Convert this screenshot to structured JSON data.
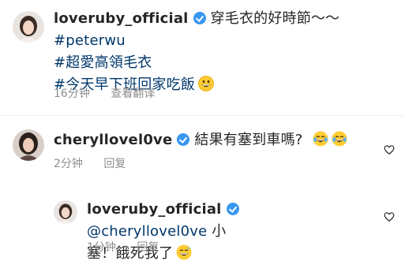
{
  "post": {
    "username": "loveruby_official",
    "caption_line1": "穿毛衣的好時節～～",
    "hashtag1": "#peterwu",
    "hashtag2": "#超愛高領毛衣",
    "hashtag3": "#今天早下班回家吃飯",
    "time": "16分钟",
    "translate": "查看翻译"
  },
  "comment1": {
    "username": "cheryllovel0ve",
    "text": "結果有塞到車嗎?",
    "time": "2分钟",
    "reply": "回复"
  },
  "reply1": {
    "username": "loveruby_official",
    "mention": "@cheryllovel0ve",
    "text_part1": " 小",
    "text_part2": "塞！餓死我了",
    "time": "1分钟",
    "reply": "回复"
  },
  "colors": {
    "verified": "#3897f0",
    "meta": "#8e8e8e",
    "link": "#00376b"
  },
  "icons": {
    "verified": "verified-badge-icon",
    "like": "heart-outline-icon",
    "emoji_grin": "grinning-face-icon",
    "emoji_tears": "tears-of-joy-icon",
    "emoji_sweat": "grinning-sweat-icon"
  }
}
